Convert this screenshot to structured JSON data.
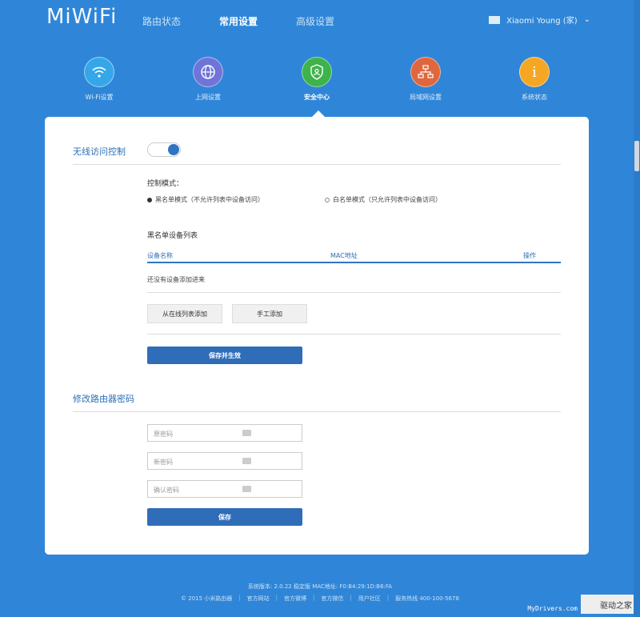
{
  "header": {
    "logo": "MiWiFi",
    "nav": [
      "路由状态",
      "常用设置",
      "高级设置"
    ],
    "user": "Xiaomi Young (家)"
  },
  "icons": [
    {
      "label": "Wi-Fi设置",
      "color": "#35a7e8",
      "icon": "wifi-icon"
    },
    {
      "label": "上网设置",
      "color": "#6f74d8",
      "icon": "globe-icon"
    },
    {
      "label": "安全中心",
      "color": "#3db34a",
      "icon": "shield-icon"
    },
    {
      "label": "局域网设置",
      "color": "#e0663d",
      "icon": "network-icon"
    },
    {
      "label": "系统状态",
      "color": "#f5a623",
      "icon": "info-icon"
    }
  ],
  "wireless": {
    "title": "无线访问控制",
    "mode_label": "控制模式：",
    "blacklist_option": "黑名单模式（不允许列表中设备访问）",
    "whitelist_option": "白名单模式（只允许列表中设备访问）",
    "list_title": "黑名单设备列表",
    "col_name": "设备名称",
    "col_mac": "MAC地址",
    "col_action": "操作",
    "empty": "还没有设备添加进来",
    "add_online": "从在线列表添加",
    "add_manual": "手工添加",
    "save_apply": "保存并生效"
  },
  "password": {
    "title": "修改路由器密码",
    "old": "原密码",
    "new": "新密码",
    "confirm": "确认密码",
    "save": "保存"
  },
  "footer": {
    "line1": "系统版本: 2.0.22 稳定版   MAC地址: F0:B4:29:1D:B6:FA",
    "links": [
      "© 2015 小米路由器",
      "官方网站",
      "官方微博",
      "官方微信",
      "用户社区",
      "服务热线 400-100-5678"
    ]
  },
  "watermark": {
    "url": "MyDrivers.com",
    "zh": "驱动之家"
  }
}
